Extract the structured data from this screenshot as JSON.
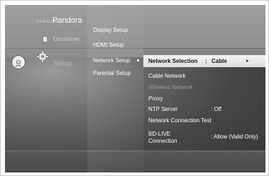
{
  "home": {
    "brand_prefix": "SAMSUNG",
    "brand": "Pandora",
    "disclaimer": "Disclaimer",
    "setup_label": "Setup"
  },
  "setup_menu": {
    "items": [
      {
        "label": "Display Setup"
      },
      {
        "label": "HDMI Setup"
      },
      {
        "label": "Network Setup"
      },
      {
        "label": "Parental Setup"
      }
    ]
  },
  "network_menu": {
    "selected": {
      "label": "Network Selection",
      "colon": ":",
      "value": "Cable",
      "arrow": "▸"
    },
    "items": [
      {
        "label": "Cable Network"
      },
      {
        "label": "Wireless Network"
      },
      {
        "label": "Proxy"
      },
      {
        "label": "NTP Server",
        "value": ": Off"
      },
      {
        "label": "Network Connection Test"
      },
      {
        "label": "BD-LIVE",
        "label2": "Connection",
        "value": ": Allow (Valid Only)"
      }
    ]
  },
  "colors": {
    "highlight": "#e8e8e8",
    "background": "#4b4b4b",
    "text": "#ffffff",
    "disabled_text": "#9a9a9a"
  },
  "icons": [
    "disclaimer-icon",
    "dvd-icon",
    "gear-icon"
  ]
}
